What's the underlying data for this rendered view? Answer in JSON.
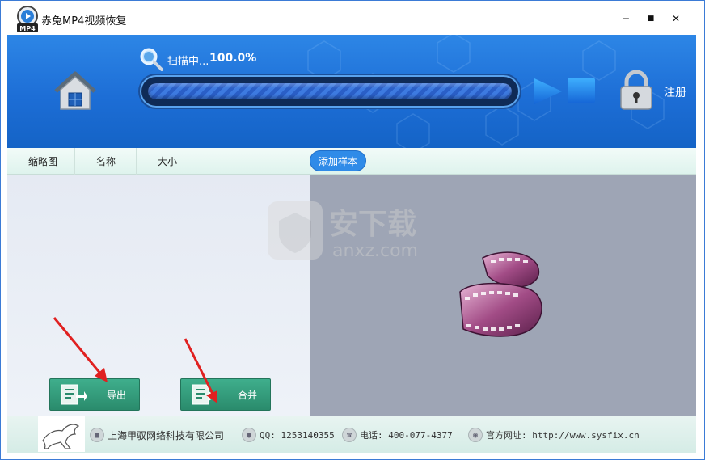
{
  "window": {
    "title": "赤兔MP4视频恢复",
    "logo_text": "MP4",
    "minimize": "−",
    "maximize": "■",
    "close": "✕"
  },
  "header": {
    "scan_label": "扫描中...",
    "scan_percent": "100.0%",
    "progress_value": 1.0,
    "register_label": "注册"
  },
  "columns": {
    "thumbnail": "缩略图",
    "name": "名称",
    "size": "大小",
    "add_sample": "添加样本"
  },
  "actions": {
    "export_label": "导出",
    "merge_label": "合并"
  },
  "watermark": {
    "text": "安下载",
    "sub": "anxz.com"
  },
  "footer": {
    "company": "上海甲驭网络科技有限公司",
    "qq": "QQ: 1253140355",
    "phone": "电话: 400-077-4377",
    "website": "官方网址: http://www.sysfix.cn"
  },
  "colors": {
    "header_blue": "#1d6ed6",
    "button_green": "#2a8b6c",
    "accent_blue": "#2f8be8"
  }
}
